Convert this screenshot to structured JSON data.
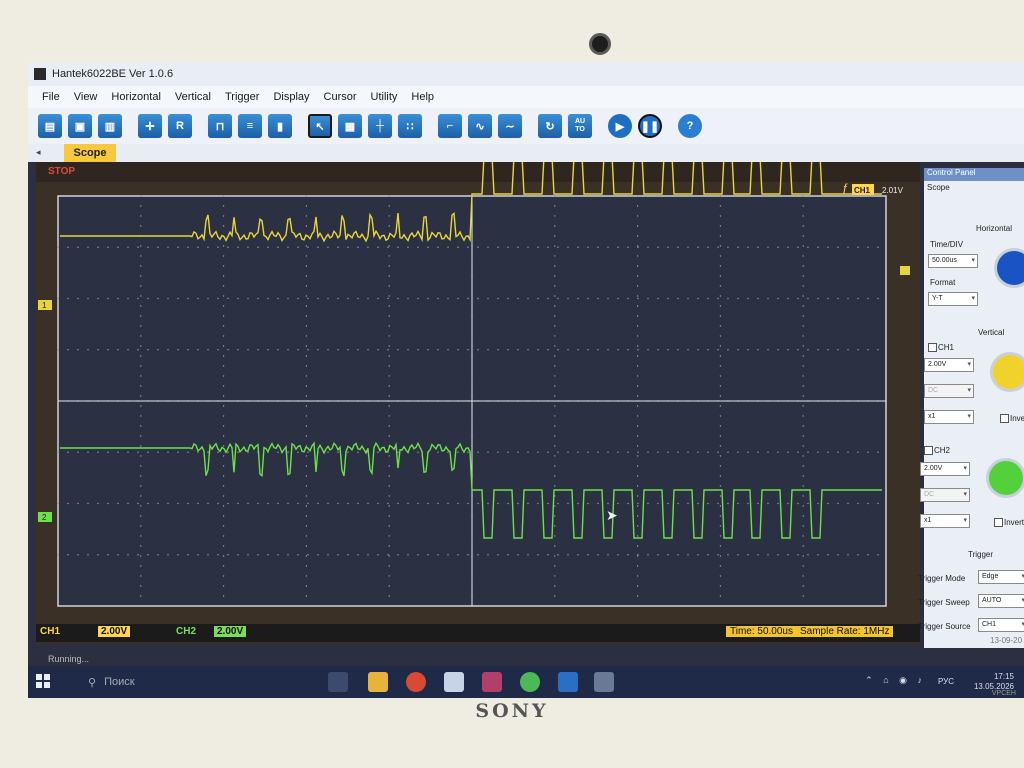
{
  "device": {
    "brand": "SONY",
    "model": "VPCEH"
  },
  "window": {
    "title": "Hantek6022BE Ver 1.0.6"
  },
  "menu": [
    "File",
    "View",
    "Horizontal",
    "Vertical",
    "Trigger",
    "Display",
    "Cursor",
    "Utility",
    "Help"
  ],
  "toolbar": {
    "icons": [
      "open-icon",
      "save-icon",
      "print-icon",
      "autoset-icon",
      "reference-icon",
      "pulse-icon",
      "measure-icon",
      "cursor-icon",
      "select-icon",
      "grid-full-icon",
      "grid-cross-icon",
      "grid-dot-icon",
      "square-wave-icon",
      "triangle-wave-icon",
      "sine-wave-icon",
      "refresh-icon",
      "auto-icon",
      "run-icon",
      "pause-icon",
      "help-icon"
    ],
    "auto_label": "AU\nTO",
    "reference_label": "R",
    "help_label": "?"
  },
  "tabs": {
    "active": "Scope"
  },
  "scope": {
    "status": "STOP",
    "trigger_channel": "CH1",
    "trigger_level": "2.01V",
    "ch1_marker": "1",
    "ch2_marker": "2",
    "ch1_volts_label": "CH1",
    "ch1_volts": "2.00V",
    "ch2_volts_label": "CH2",
    "ch2_volts": "2.00V",
    "time": "Time: 50.00us",
    "sample_rate": "Sample Rate: 1MHz",
    "running": "Running...",
    "colors": {
      "ch1": "#e8d53a",
      "ch2": "#6ee04a",
      "grid": "#cfd3dc",
      "background": "#2b3042"
    }
  },
  "control_panel": {
    "title": "Control Panel",
    "tab": "Scope",
    "horizontal": {
      "heading": "Horizontal",
      "timediv_label": "Time/DIV",
      "timediv_value": "50.00us",
      "format_label": "Format",
      "format_value": "Y-T"
    },
    "vertical": {
      "heading": "Vertical",
      "ch1_label": "CH1",
      "ch1_volts": "2.00V",
      "ch1_coupling": "DC",
      "ch1_probe": "x1",
      "ch2_label": "CH2",
      "ch2_volts": "2.00V",
      "ch2_coupling": "DC",
      "ch2_probe": "x1",
      "invert_label": "Invert",
      "invert_label_ch2": "Invert"
    },
    "trigger": {
      "heading": "Trigger",
      "mode_label": "Trigger Mode",
      "mode_value": "Edge",
      "sweep_label": "Trigger Sweep",
      "sweep_value": "AUTO",
      "source_label": "Trigger Source",
      "source_value": "CH1"
    },
    "date_stamp": "13-09-20"
  },
  "taskbar": {
    "search_placeholder": "Поиск",
    "language": "РУС",
    "time": "17:15",
    "date": "13.05.2026"
  }
}
